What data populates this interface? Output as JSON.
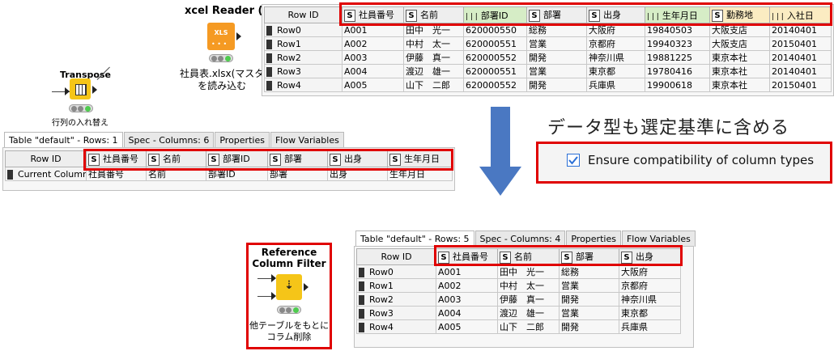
{
  "top_node": {
    "title": "xcel Reader (XLS",
    "icon_text": "XLS",
    "label_lines": [
      "社員表.xlsx(マスタ",
      "を読み込む"
    ]
  },
  "transpose_node": {
    "title": "Transpose",
    "label": "行列の入れ替え"
  },
  "rcf_node": {
    "title_lines": [
      "Reference",
      "Column Filter"
    ],
    "label_lines": [
      "他テーブルをもとに",
      "コラム削除"
    ]
  },
  "top_table": {
    "rowid_header": "Row ID",
    "type_badge": "S",
    "columns": [
      "社員番号",
      "名前",
      "部署ID",
      "部署",
      "出身",
      "生年月日",
      "勤務地",
      "入社日"
    ],
    "rows": [
      {
        "id": "Row0",
        "cells": [
          "A001",
          "田中　光一",
          "620000550",
          "総務",
          "大阪府",
          "19840503",
          "大阪支店",
          "20140401"
        ]
      },
      {
        "id": "Row1",
        "cells": [
          "A002",
          "中村　太一",
          "620000551",
          "営業",
          "京都府",
          "19940323",
          "大阪支店",
          "20150401"
        ]
      },
      {
        "id": "Row2",
        "cells": [
          "A003",
          "伊藤　真一",
          "620000552",
          "開発",
          "神奈川県",
          "19881225",
          "東京本社",
          "20140401"
        ]
      },
      {
        "id": "Row3",
        "cells": [
          "A004",
          "渡辺　雄一",
          "620000551",
          "営業",
          "東京都",
          "19780416",
          "東京本社",
          "20140401"
        ]
      },
      {
        "id": "Row4",
        "cells": [
          "A005",
          "山下　二郎",
          "620000552",
          "開発",
          "兵庫県",
          "19900618",
          "東京本社",
          "20150401"
        ]
      }
    ]
  },
  "mid_table": {
    "tabs": [
      "Table \"default\" - Rows: 1",
      "Spec - Columns: 6",
      "Properties",
      "Flow Variables"
    ],
    "rowid_header": "Row ID",
    "type_badge": "S",
    "columns": [
      "社員番号",
      "名前",
      "部署ID",
      "部署",
      "出身",
      "生年月日"
    ],
    "rows": [
      {
        "id": "Current Column",
        "cells": [
          "社員番号",
          "名前",
          "部署ID",
          "部署",
          "出身",
          "生年月日"
        ]
      }
    ]
  },
  "annotation": {
    "text": "データ型も選定基準に含める",
    "checkbox_label": "Ensure compatibility of column types",
    "checked": true
  },
  "bottom_table": {
    "tabs": [
      "Table \"default\" - Rows: 5",
      "Spec - Columns: 4",
      "Properties",
      "Flow Variables"
    ],
    "rowid_header": "Row ID",
    "type_badge": "S",
    "columns": [
      "社員番号",
      "名前",
      "部署",
      "出身"
    ],
    "rows": [
      {
        "id": "Row0",
        "cells": [
          "A001",
          "田中　光一",
          "総務",
          "大阪府"
        ]
      },
      {
        "id": "Row1",
        "cells": [
          "A002",
          "中村　太一",
          "営業",
          "京都府"
        ]
      },
      {
        "id": "Row2",
        "cells": [
          "A003",
          "伊藤　真一",
          "開発",
          "神奈川県"
        ]
      },
      {
        "id": "Row3",
        "cells": [
          "A004",
          "渡辺　雄一",
          "営業",
          "東京都"
        ]
      },
      {
        "id": "Row4",
        "cells": [
          "A005",
          "山下　二郎",
          "開発",
          "兵庫県"
        ]
      }
    ]
  },
  "colors": {
    "highlight_red": "#e00000",
    "node_orange": "#f59a23",
    "node_yellow": "#f5c518",
    "arrow_blue": "#4a78c2",
    "checkbox_blue": "#2a6fd6"
  }
}
